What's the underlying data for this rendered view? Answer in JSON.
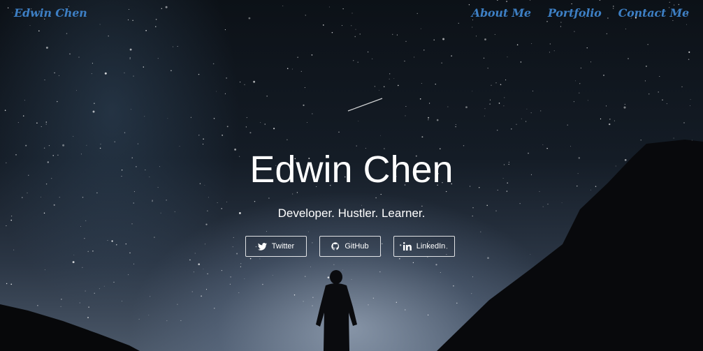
{
  "nav": {
    "brand": "Edwin Chen",
    "links": [
      "About Me",
      "Portfolio",
      "Contact Me"
    ]
  },
  "hero": {
    "title": "Edwin Chen",
    "tagline": "Developer. Hustler. Learner."
  },
  "social": [
    {
      "label": "Twitter",
      "icon": "twitter-icon"
    },
    {
      "label": "GitHub",
      "icon": "github-icon"
    },
    {
      "label": "LinkedIn",
      "icon": "linkedin-icon"
    }
  ],
  "colors": {
    "accent": "#3d7fc4",
    "text": "#ffffff",
    "sky": "#141c26"
  }
}
